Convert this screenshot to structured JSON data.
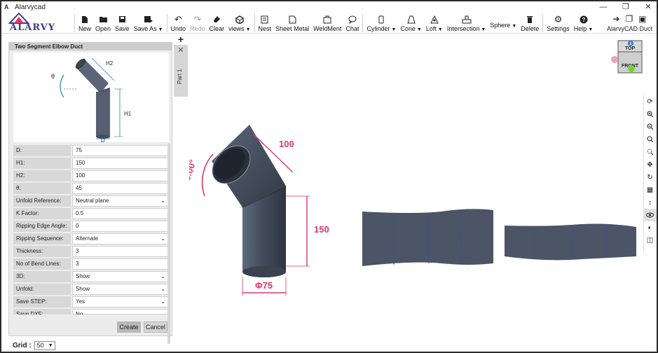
{
  "window": {
    "title": "Alarvycad",
    "app_icon": "A"
  },
  "logo": {
    "text": "ALARVY"
  },
  "toolbar": [
    {
      "label": "New",
      "icon": "new-file-icon"
    },
    {
      "label": "Open",
      "icon": "open-folder-icon"
    },
    {
      "label": "Save",
      "icon": "save-icon"
    },
    {
      "label": "Save As",
      "icon": "save-as-icon",
      "dropdown": true
    },
    {
      "label": "Undo",
      "icon": "undo-icon"
    },
    {
      "label": "Redo",
      "icon": "redo-icon",
      "disabled": true
    },
    {
      "label": "Clear",
      "icon": "eraser-icon"
    },
    {
      "label": "views",
      "icon": "cube-views-icon",
      "dropdown": true
    },
    {
      "label": "Nest",
      "icon": "nest-icon"
    },
    {
      "label": "Sheet Metal",
      "icon": "sheet-metal-icon"
    },
    {
      "label": "WeldMent",
      "icon": "weldment-icon"
    },
    {
      "label": "Chat",
      "icon": "chat-icon"
    },
    {
      "label": "Cylinder",
      "icon": "cylinder-icon",
      "dropdown": true
    },
    {
      "label": "Cone",
      "icon": "cone-icon",
      "dropdown": true
    },
    {
      "label": "Loft",
      "icon": "loft-icon",
      "dropdown": true
    },
    {
      "label": "Intersection",
      "icon": "intersection-icon",
      "dropdown": true
    },
    {
      "label": "Sphere",
      "icon": "sphere-icon",
      "dropdown": true
    },
    {
      "label": "Delete",
      "icon": "trash-icon"
    },
    {
      "label": "Settings",
      "icon": "gear-icon"
    },
    {
      "label": "Help",
      "icon": "help-icon",
      "dropdown": true
    }
  ],
  "ribbon_right": {
    "label": "AlarvyCAD Duct"
  },
  "panel": {
    "title": "Two Segment Elbow Duct",
    "diagram_labels": {
      "theta": "θ",
      "h1": "H1",
      "h2": "H2",
      "d": "D"
    },
    "fields": [
      {
        "label": "D:",
        "value": "75"
      },
      {
        "label": "H1:",
        "value": "150"
      },
      {
        "label": "H2:",
        "value": "100"
      },
      {
        "label": "θ:",
        "value": "45"
      },
      {
        "label": "Unfold Reference:",
        "value": "Neutral plane",
        "select": true
      },
      {
        "label": "K Factor:",
        "value": "0.5"
      },
      {
        "label": "Ripping Edge Angle:",
        "value": "0"
      },
      {
        "label": "Ripping Sequence:",
        "value": "Alternate",
        "select": true
      },
      {
        "label": "Thickness:",
        "value": "3"
      },
      {
        "label": "No of Bend Lines:",
        "value": "3"
      },
      {
        "label": "3D:",
        "value": "Show",
        "select": true
      },
      {
        "label": "Unfold:",
        "value": "Show",
        "select": true
      },
      {
        "label": "Save STEP:",
        "value": "Yes",
        "select": true
      },
      {
        "label": "Save DXF:",
        "value": "No",
        "select": true
      }
    ],
    "create_label": "Create",
    "cancel_label": "Cancel"
  },
  "tabs": {
    "add": "+",
    "close": "✕",
    "part": "Part 1"
  },
  "model": {
    "dim_angle": "45.00°",
    "dim_h2": "100",
    "dim_h1": "150",
    "dim_d": "Φ75",
    "accent_color": "#e0366b",
    "duct_color": "#4a5568"
  },
  "viewcube": {
    "top": "TOP",
    "front": "FRONT",
    "axis_z": "Z"
  },
  "right_tools": [
    "rotate-icon",
    "zoom-in-icon",
    "zoom-out-icon",
    "zoom-fit-icon",
    "zoom-window-icon",
    "pan-icon",
    "refresh-icon",
    "grid-icon",
    "vertical-arrows-icon",
    "eye-icon",
    "contrast-icon",
    "layers-icon"
  ],
  "status": {
    "grid_label": "Grid :",
    "grid_value": "50"
  }
}
